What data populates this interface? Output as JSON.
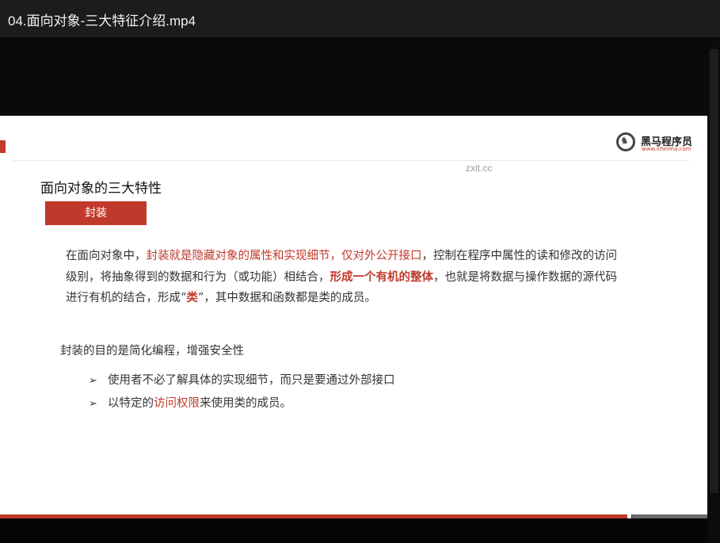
{
  "window": {
    "title": "04.面向对象-三大特征介绍.mp4"
  },
  "watermark": "zxit.cc",
  "logo": {
    "name": "黑马程序员",
    "url": "www.itheima.com"
  },
  "slide": {
    "title": "面向对象的三大特性",
    "tag": "封装",
    "paragraph": [
      {
        "text": "在面向对象中，",
        "style": "normal"
      },
      {
        "text": "封装就是隐藏对象的属性和实现细节，仅对外公开接口",
        "style": "red"
      },
      {
        "text": "，控制在程序中属性的读和修改的访问级别，将抽象得到的数据和行为（或功能）相结合，",
        "style": "normal"
      },
      {
        "text": "形成一个有机的整体",
        "style": "red-bold"
      },
      {
        "text": "，也就是将数据与操作数据的源代码进行有机的结合，形成“",
        "style": "normal"
      },
      {
        "text": "类",
        "style": "red-bold"
      },
      {
        "text": "”，其中数据和函数都是类的成员。",
        "style": "normal"
      }
    ],
    "subhead": "封装的目的是简化编程，增强安全性",
    "bullets": [
      {
        "marker": "➢",
        "parts": [
          {
            "text": "使用者不必了解具体的实现细节，而只是要通过外部接口",
            "style": "normal"
          }
        ]
      },
      {
        "marker": "➢",
        "parts": [
          {
            "text": "以特定的",
            "style": "normal"
          },
          {
            "text": "访问权限",
            "style": "red"
          },
          {
            "text": "来使用类的成员。",
            "style": "normal"
          }
        ]
      }
    ]
  },
  "player": {
    "progress": 0.888,
    "buffered": 0.112
  },
  "colors": {
    "accent": "#c0392b",
    "titlebar": "#1c1c1c",
    "background": "#000000"
  }
}
